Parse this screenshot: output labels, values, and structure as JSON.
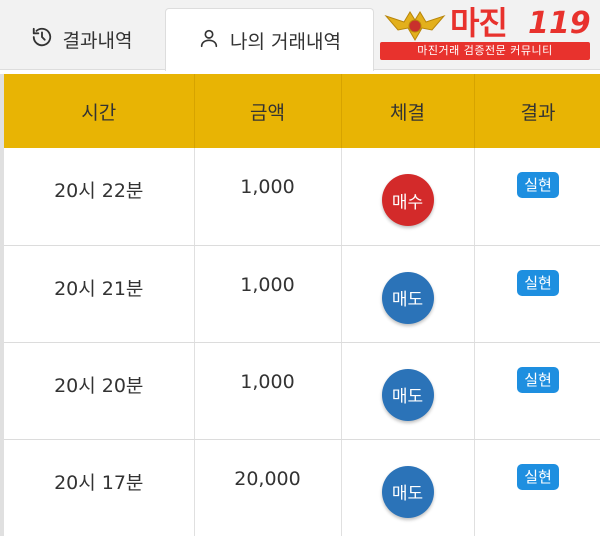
{
  "tabs": [
    {
      "label": "결과내역",
      "icon": "history-icon"
    },
    {
      "label": "나의 거래내역",
      "icon": "user-icon"
    }
  ],
  "logo": {
    "title": "마진",
    "number": "119",
    "tagline": "마진거래 검증전문 커뮤니티"
  },
  "table": {
    "headers": [
      "시간",
      "금액",
      "체결",
      "결과"
    ],
    "rows": [
      {
        "time": "20시 22분",
        "amount": "1,000",
        "side": "매수",
        "side_type": "buy",
        "result": "실현"
      },
      {
        "time": "20시 21분",
        "amount": "1,000",
        "side": "매도",
        "side_type": "sell",
        "result": "실현"
      },
      {
        "time": "20시 20분",
        "amount": "1,000",
        "side": "매도",
        "side_type": "sell",
        "result": "실현"
      },
      {
        "time": "20시 17분",
        "amount": "20,000",
        "side": "매도",
        "side_type": "sell",
        "result": "실현"
      }
    ]
  },
  "colors": {
    "header_bg": "#e8b404",
    "buy": "#d32a2a",
    "sell": "#2b73b8",
    "badge": "#1e8fe0",
    "brand": "#e8322d"
  }
}
